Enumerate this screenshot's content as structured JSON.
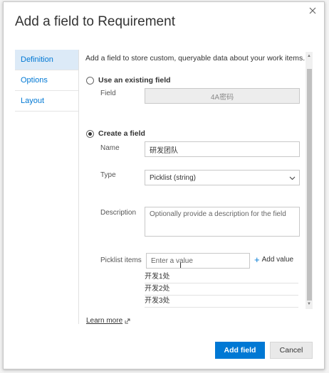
{
  "dialog": {
    "title": "Add a field to Requirement",
    "close_icon": "close-icon"
  },
  "nav": {
    "items": [
      {
        "label": "Definition",
        "selected": true
      },
      {
        "label": "Options",
        "selected": false
      },
      {
        "label": "Layout",
        "selected": false
      }
    ]
  },
  "content": {
    "intro": "Add a field to store custom, queryable data about your work items.",
    "existing": {
      "radio_label": "Use an existing field",
      "field_label": "Field",
      "field_value": "4A密码"
    },
    "create": {
      "radio_label": "Create a field",
      "name_label": "Name",
      "name_value": "研发团队",
      "type_label": "Type",
      "type_value": "Picklist (string)",
      "description_label": "Description",
      "description_placeholder": "Optionally provide a description for the field",
      "picklist_label": "Picklist items",
      "picklist_placeholder": "Enter a value",
      "add_value_label": "Add value",
      "picklist_items": [
        "开发1处",
        "开发2处",
        "开发3处"
      ]
    }
  },
  "footer": {
    "learn_more": "Learn more",
    "add_field": "Add field",
    "cancel": "Cancel"
  },
  "colors": {
    "accent": "#0078d4",
    "nav_selected_bg": "#dceaf7"
  }
}
